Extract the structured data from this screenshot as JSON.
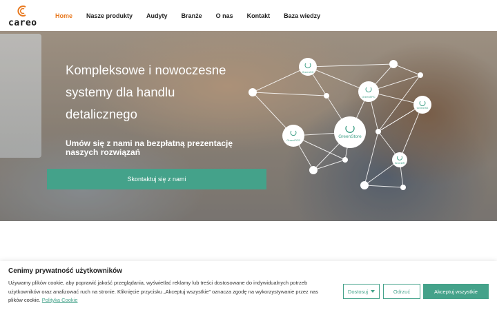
{
  "brand": {
    "logo_text": "careo"
  },
  "nav": [
    {
      "label": "Home",
      "active": true
    },
    {
      "label": "Nasze produkty",
      "active": false
    },
    {
      "label": "Audyty",
      "active": false
    },
    {
      "label": "Branże",
      "active": false
    },
    {
      "label": "O nas",
      "active": false
    },
    {
      "label": "Kontakt",
      "active": false
    },
    {
      "label": "Baza wiedzy",
      "active": false
    }
  ],
  "hero": {
    "title_lines": [
      "Kompleksowe i nowoczesne",
      "systemy dla handlu",
      "detalicznego"
    ],
    "subtitle": "Umów się z nami na bezpłatną prezentację naszych rozwiązań",
    "cta_label": "Skontaktuj się z nami",
    "network_labels": {
      "main": "GreenStore",
      "gc": "GreenGC",
      "epc": "GreenEPC",
      "pos": "GreenPOS",
      "ess": "GreenESS",
      "br": "GreenBR"
    }
  },
  "cookie": {
    "title": "Cenimy prywatność użytkowników",
    "text": "Używamy plików cookie, aby poprawić jakość przeglądania, wyświetlać reklamy lub treści dostosowane do indywidualnych potrzeb użytkowników oraz analizować ruch na stronie. Kliknięcie przycisku „Akceptuj wszystkie” oznacza zgodę na wykorzystywanie przez nas plików cookie.",
    "policy_link": "Polityka Cookie",
    "customize_label": "Dostosuj",
    "reject_label": "Odrzuć",
    "accept_label": "Akceptuj wszystkie"
  },
  "colors": {
    "accent": "#e8791f",
    "brand_green": "#44a28a"
  }
}
